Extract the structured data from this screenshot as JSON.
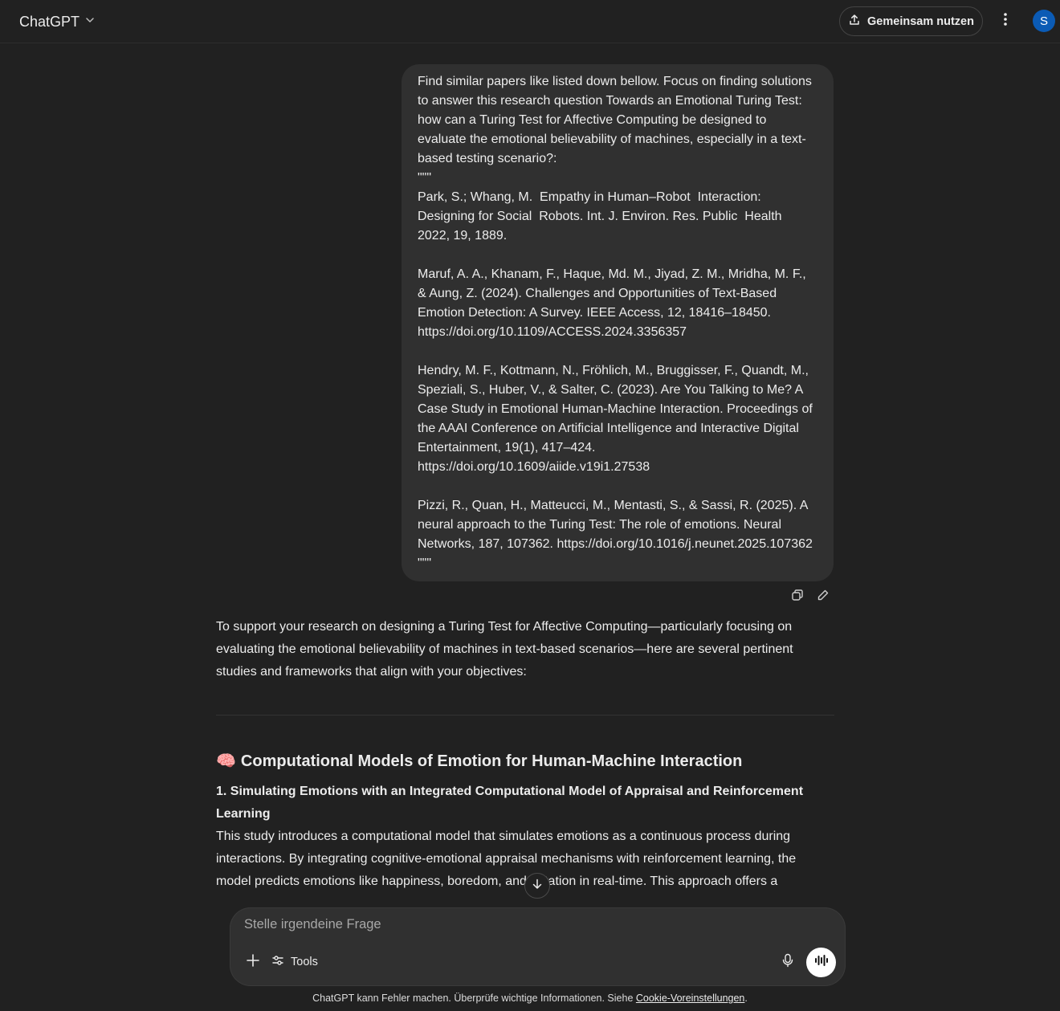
{
  "header": {
    "title": "ChatGPT",
    "share_label": "Gemeinsam nutzen",
    "avatar_initial": "S"
  },
  "user_message": {
    "text": "Find similar papers like listed down bellow. Focus on finding solutions to answer this research question Towards an Emotional Turing Test: how can a Turing Test for Affective Computing be designed to evaluate the emotional believability of machines, especially in a text-based testing scenario?:\n\"\"\"\nPark, S.; Whang, M.  Empathy in Human–Robot  Interaction: Designing for Social  Robots. Int. J. Environ. Res. Public  Health 2022, 19, 1889.\n\nMaruf, A. A., Khanam, F., Haque, Md. M., Jiyad, Z. M., Mridha, M. F., & Aung, Z. (2024). Challenges and Opportunities of Text-Based Emotion Detection: A Survey. IEEE Access, 12, 18416–18450. https://doi.org/10.1109/ACCESS.2024.3356357\n\nHendry, M. F., Kottmann, N., Fröhlich, M., Bruggisser, F., Quandt, M., Speziali, S., Huber, V., & Salter, C. (2023). Are You Talking to Me? A Case Study in Emotional Human-Machine Interaction. Proceedings of the AAAI Conference on Artificial Intelligence and Interactive Digital Entertainment, 19(1), 417–424. https://doi.org/10.1609/aiide.v19i1.27538\n\nPizzi, R., Quan, H., Matteucci, M., Mentasti, S., & Sassi, R. (2025). A neural approach to the Turing Test: The role of emotions. Neural Networks, 187, 107362. https://doi.org/10.1016/j.neunet.2025.107362\n\"\"\""
  },
  "assistant": {
    "intro": "To support your research on designing a Turing Test for Affective Computing—particularly focusing on evaluating the emotional believability of machines in text-based scenarios—here are several pertinent studies and frameworks that align with your objectives:",
    "section_emoji": "🧠",
    "section_heading": "Computational Models of Emotion for Human-Machine Interaction",
    "item_title": "1. Simulating Emotions with an Integrated Computational Model of Appraisal and Reinforcement Learning",
    "item_body": "This study introduces a computational model that simulates emotions as a continuous process during interactions. By integrating cognitive-emotional appraisal mechanisms with reinforcement learning, the model predicts emotions like happiness, boredom, and irritation in real-time. This approach offers a framework for machines to adapt to users' emotional states, enhancing user experience and engagement."
  },
  "composer": {
    "placeholder": "Stelle irgendeine Frage",
    "tools_label": "Tools"
  },
  "footer": {
    "text": "ChatGPT kann Fehler machen. Überprüfe wichtige Informationen. Siehe ",
    "link": "Cookie-Voreinstellungen",
    "end": "."
  }
}
